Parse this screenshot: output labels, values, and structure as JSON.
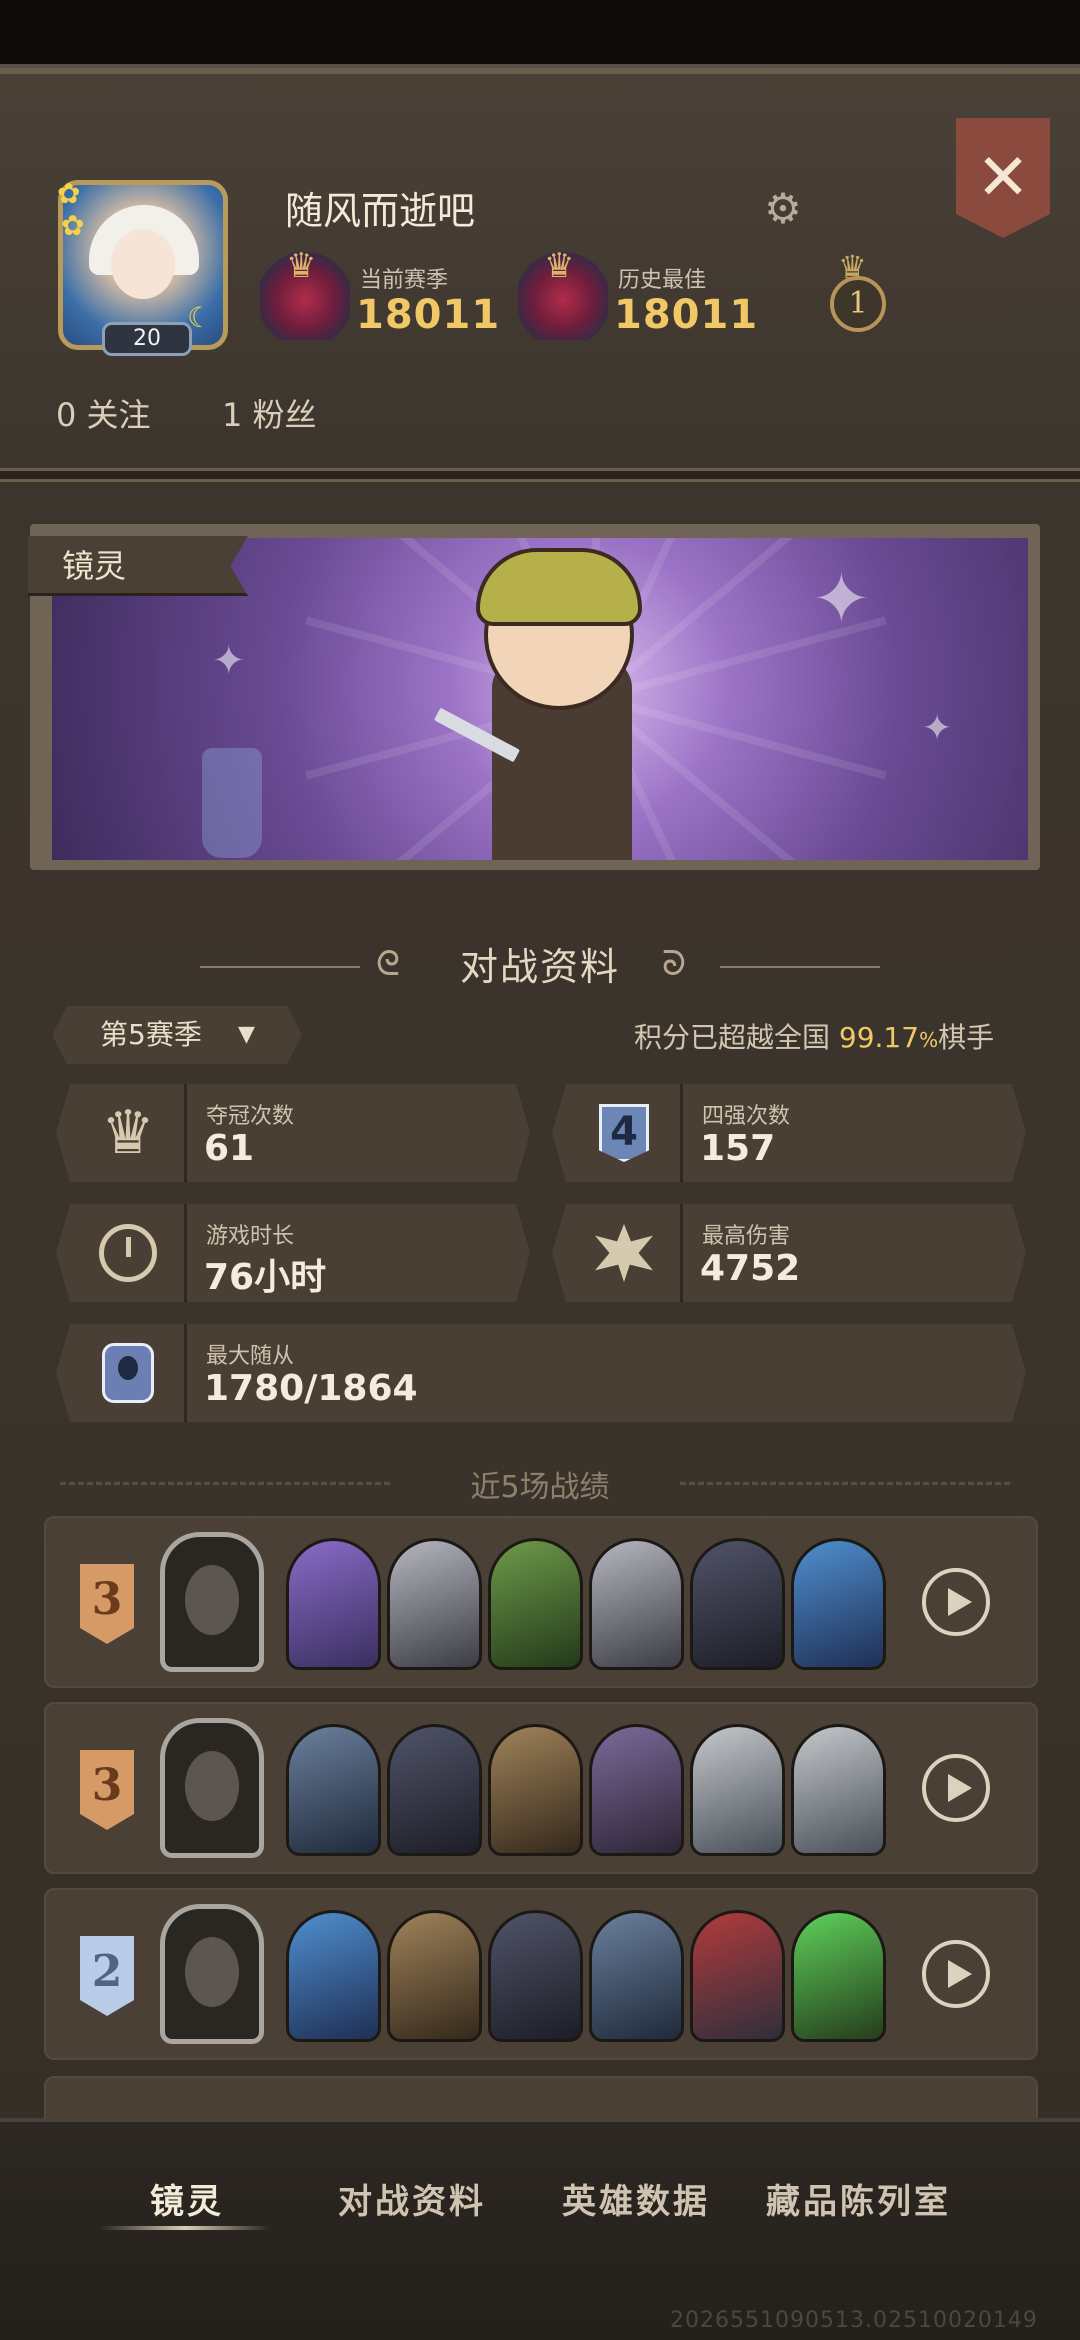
{
  "profile": {
    "username": "随风而逝吧",
    "level": "20",
    "current_season_label": "当前赛季",
    "current_season_score": "18011",
    "history_best_label": "历史最佳",
    "history_best_score": "18011",
    "crown_rank": "1",
    "following": "0 关注",
    "followers": "1 粉丝"
  },
  "banner": {
    "tag": "镜灵"
  },
  "battle": {
    "section_title": "对战资料",
    "season_selector": "第5赛季",
    "percentile_prefix": "积分已超越全国 ",
    "percentile_value": "99.17",
    "percentile_unit": "%",
    "percentile_suffix": "棋手",
    "stats": {
      "championships_label": "夺冠次数",
      "championships_value": "61",
      "top4_label": "四强次数",
      "top4_value": "157",
      "playtime_label": "游戏时长",
      "playtime_value": "76小时",
      "max_damage_label": "最高伤害",
      "max_damage_value": "4752",
      "max_minion_label": "最大随从",
      "max_minion_value": "1780/1864"
    },
    "top4_icon_text": "4"
  },
  "recent": {
    "title": "近5场战绩",
    "matches": [
      {
        "placement": "3",
        "medal": "bronze",
        "minions": [
          "m-a",
          "m-b",
          "m-c",
          "m-b",
          "m-d",
          "m-e"
        ]
      },
      {
        "placement": "3",
        "medal": "bronze",
        "minions": [
          "m-f",
          "m-d",
          "m-g",
          "m-h",
          "m-i",
          "m-i"
        ]
      },
      {
        "placement": "2",
        "medal": "silver",
        "minions": [
          "m-e",
          "m-g",
          "m-d",
          "m-f",
          "m-j",
          "m-k"
        ]
      }
    ]
  },
  "nav": {
    "items": [
      "镜灵",
      "对战资料",
      "英雄数据",
      "藏品陈列室"
    ],
    "active": "镜灵"
  },
  "build_id": "2026551090513.02510020149"
}
